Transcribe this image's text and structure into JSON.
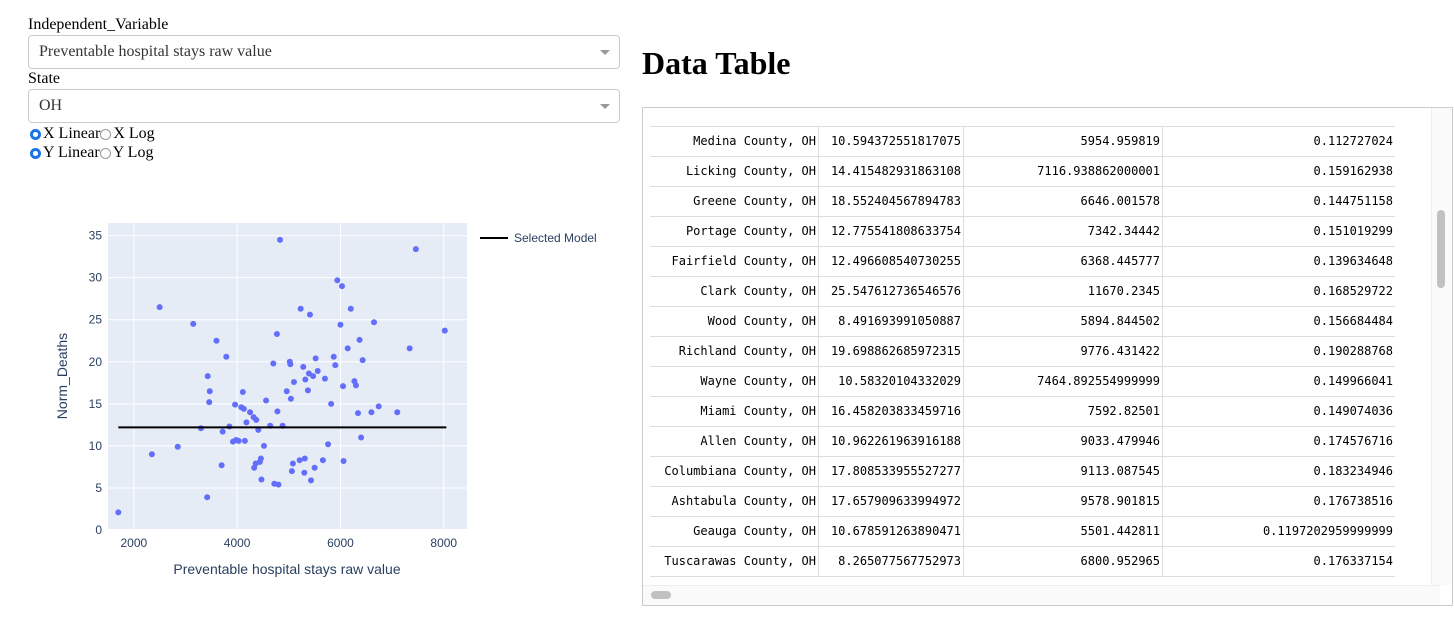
{
  "controls": {
    "independent_label": "Independent_Variable",
    "independent_value": "Preventable hospital stays raw value",
    "state_label": "State",
    "state_value": "OH",
    "x_linear": "X Linear",
    "x_log": "X Log",
    "y_linear": "Y Linear",
    "y_log": "Y Log",
    "x_scale_selected": "X Linear",
    "y_scale_selected": "Y Linear"
  },
  "table": {
    "title": "Data Table",
    "rows": [
      [
        "Medina County, OH",
        "10.594372551817075",
        "5954.959819",
        "0.112727024"
      ],
      [
        "Licking County, OH",
        "14.415482931863108",
        "7116.938862000001",
        "0.159162938"
      ],
      [
        "Greene County, OH",
        "18.552404567894783",
        "6646.001578",
        "0.144751158"
      ],
      [
        "Portage County, OH",
        "12.775541808633754",
        "7342.34442",
        "0.151019299"
      ],
      [
        "Fairfield County, OH",
        "12.496608540730255",
        "6368.445777",
        "0.139634648"
      ],
      [
        "Clark County, OH",
        "25.547612736546576",
        "11670.2345",
        "0.168529722"
      ],
      [
        "Wood County, OH",
        "8.491693991050887",
        "5894.844502",
        "0.156684484"
      ],
      [
        "Richland County, OH",
        "19.698862685972315",
        "9776.431422",
        "0.190288768"
      ],
      [
        "Wayne County, OH",
        "10.58320104332029",
        "7464.892554999999",
        "0.149966041"
      ],
      [
        "Miami County, OH",
        "16.458203833459716",
        "7592.82501",
        "0.149074036"
      ],
      [
        "Allen County, OH",
        "10.962261963916188",
        "9033.479946",
        "0.174576716"
      ],
      [
        "Columbiana County, OH",
        "17.808533955527277",
        "9113.087545",
        "0.183234946"
      ],
      [
        "Ashtabula County, OH",
        "17.657909633994972",
        "9578.901815",
        "0.176738516"
      ],
      [
        "Geauga County, OH",
        "10.678591263890471",
        "5501.442811",
        "0.1197202959999999"
      ],
      [
        "Tuscarawas County, OH",
        "8.265077567752973",
        "6800.952965",
        "0.176337154"
      ]
    ]
  },
  "colors": {
    "accent": "#1a73e8",
    "points": "#636efa",
    "plot_bg": "#e5ecf6",
    "line": "#000000"
  },
  "chart_data": {
    "type": "scatter",
    "xlabel": "Preventable hospital stays raw value",
    "ylabel": "Norm_Deaths",
    "xlim": [
      1500,
      8450
    ],
    "ylim": [
      0,
      36.5
    ],
    "xticks": [
      2000,
      4000,
      6000,
      8000
    ],
    "yticks": [
      0,
      5,
      10,
      15,
      20,
      25,
      30,
      35
    ],
    "legend": "Selected Model",
    "legend_position": "top-right",
    "grid": true,
    "model_line": {
      "x": [
        1700,
        8050
      ],
      "y": [
        12.2,
        12.2
      ]
    },
    "points": [
      [
        1700,
        2.1
      ],
      [
        2350,
        9
      ],
      [
        2500,
        26.5
      ],
      [
        2850,
        9.9
      ],
      [
        3150,
        24.5
      ],
      [
        3300,
        12.1
      ],
      [
        3420,
        3.9
      ],
      [
        3430,
        18.3
      ],
      [
        3470,
        16.5
      ],
      [
        3460,
        15.2
      ],
      [
        3600,
        22.5
      ],
      [
        3700,
        7.7
      ],
      [
        3720,
        11.7
      ],
      [
        3790,
        20.6
      ],
      [
        3850,
        12.3
      ],
      [
        3920,
        10.5
      ],
      [
        3980,
        10.7
      ],
      [
        3960,
        14.9
      ],
      [
        4030,
        10.6
      ],
      [
        4080,
        14.6
      ],
      [
        4110,
        16.4
      ],
      [
        4130,
        14.4
      ],
      [
        4150,
        10.6
      ],
      [
        4180,
        12.8
      ],
      [
        4250,
        14
      ],
      [
        4320,
        13.4
      ],
      [
        4330,
        7.4
      ],
      [
        4360,
        7.9
      ],
      [
        4370,
        13.1
      ],
      [
        4410,
        11.9
      ],
      [
        4440,
        8.1
      ],
      [
        4460,
        8.5
      ],
      [
        4470,
        6
      ],
      [
        4520,
        10
      ],
      [
        4560,
        15.4
      ],
      [
        4640,
        12.4
      ],
      [
        4700,
        19.8
      ],
      [
        4720,
        5.5
      ],
      [
        4770,
        23.3
      ],
      [
        4780,
        14.1
      ],
      [
        4800,
        5.4
      ],
      [
        4830,
        34.5
      ],
      [
        4880,
        12.4
      ],
      [
        4960,
        16.5
      ],
      [
        5020,
        20
      ],
      [
        5030,
        19.7
      ],
      [
        5040,
        15.6
      ],
      [
        5060,
        7
      ],
      [
        5080,
        7.9
      ],
      [
        5100,
        17.6
      ],
      [
        5210,
        8.3
      ],
      [
        5230,
        26.3
      ],
      [
        5280,
        19.4
      ],
      [
        5300,
        6.8
      ],
      [
        5310,
        8.5
      ],
      [
        5320,
        17.9
      ],
      [
        5370,
        16.6
      ],
      [
        5390,
        18.6
      ],
      [
        5410,
        25.6
      ],
      [
        5430,
        5.9
      ],
      [
        5470,
        18.3
      ],
      [
        5500,
        7.4
      ],
      [
        5520,
        20.4
      ],
      [
        5560,
        18.9
      ],
      [
        5660,
        8.3
      ],
      [
        5700,
        18
      ],
      [
        5760,
        10.2
      ],
      [
        5820,
        15
      ],
      [
        5870,
        20.6
      ],
      [
        5900,
        19.6
      ],
      [
        5940,
        29.7
      ],
      [
        6000,
        24.4
      ],
      [
        6030,
        29
      ],
      [
        6050,
        17.1
      ],
      [
        6060,
        8.2
      ],
      [
        6140,
        21.6
      ],
      [
        6200,
        26.3
      ],
      [
        6270,
        17.7
      ],
      [
        6300,
        17.2
      ],
      [
        6340,
        13.9
      ],
      [
        6370,
        22.6
      ],
      [
        6400,
        11
      ],
      [
        6430,
        20.2
      ],
      [
        6600,
        14
      ],
      [
        6650,
        24.7
      ],
      [
        6740,
        14.7
      ],
      [
        7100,
        14
      ],
      [
        7340,
        21.6
      ],
      [
        7460,
        33.4
      ],
      [
        8020,
        23.7
      ]
    ]
  }
}
